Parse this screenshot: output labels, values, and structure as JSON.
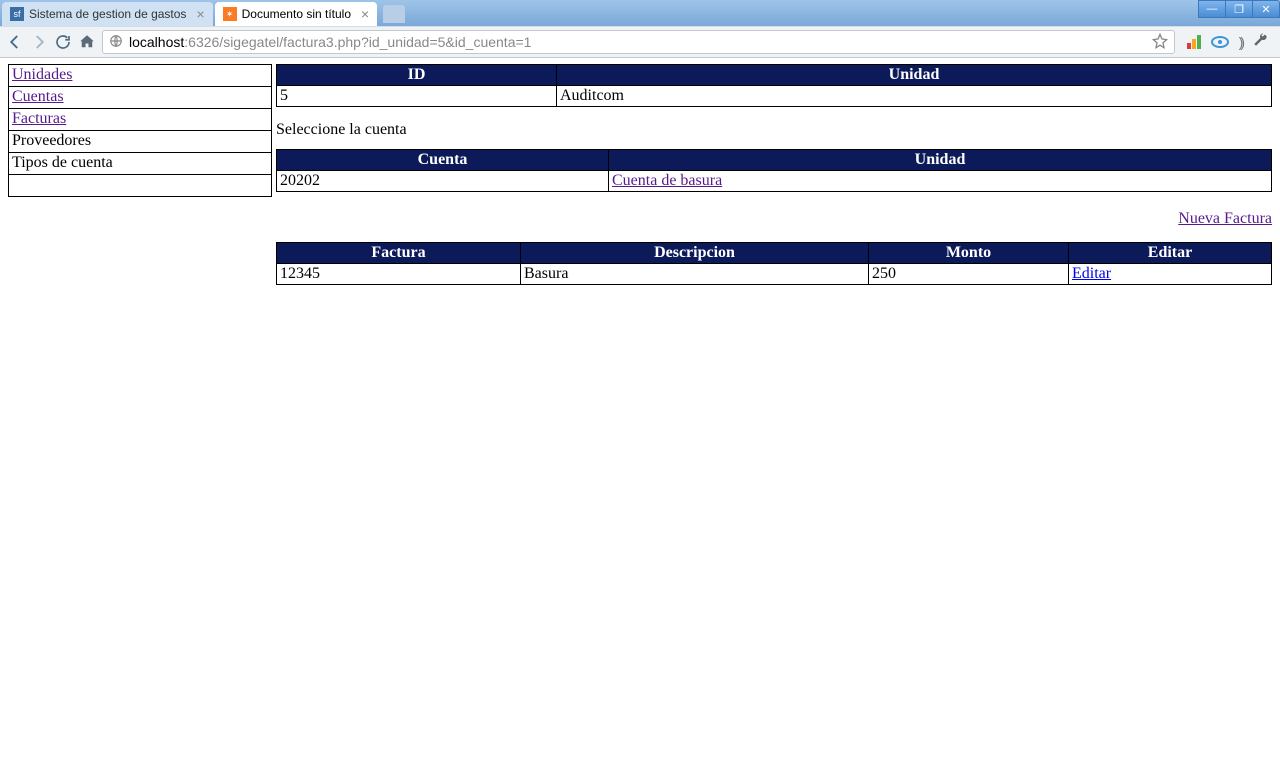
{
  "browser": {
    "tabs": [
      {
        "title": "Sistema de gestion de gastos",
        "favicon": "sf"
      },
      {
        "title": "Documento sin título",
        "favicon": "xa"
      }
    ],
    "url_host": "localhost",
    "url_rest": ":6326/sigegatel/factura3.php?id_unidad=5&id_cuenta=1"
  },
  "sidebar": {
    "items": [
      {
        "label": "Unidades",
        "link": true
      },
      {
        "label": "Cuentas",
        "link": true
      },
      {
        "label": "Facturas",
        "link": true
      },
      {
        "label": "Proveedores",
        "link": false
      },
      {
        "label": "Tipos de cuenta",
        "link": false
      }
    ]
  },
  "unit_table": {
    "headers": {
      "id": "ID",
      "unidad": "Unidad"
    },
    "row": {
      "id": "5",
      "unidad": "Auditcom"
    }
  },
  "prompt": "Seleccione la cuenta",
  "cuenta_table": {
    "headers": {
      "cuenta": "Cuenta",
      "unidad": "Unidad"
    },
    "row": {
      "cuenta": "20202",
      "unidad": "Cuenta de basura"
    }
  },
  "new_factura_link": "Nueva Factura",
  "factura_table": {
    "headers": {
      "factura": "Factura",
      "descripcion": "Descripcion",
      "monto": "Monto",
      "editar": "Editar"
    },
    "row": {
      "factura": "12345",
      "descripcion": "Basura",
      "monto": "250",
      "editar": "Editar"
    }
  }
}
